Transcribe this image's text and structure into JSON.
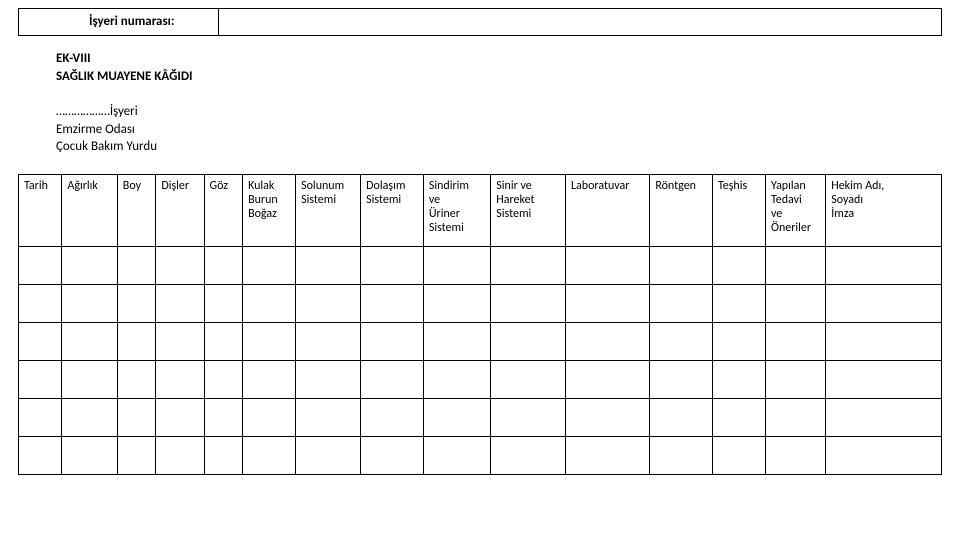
{
  "top_field": {
    "label": "İşyeri numarası:",
    "value": ""
  },
  "section_code": "EK-VIII",
  "section_title": "SAĞLIK MUAYENE KÂĞIDI",
  "institution_line1": "………………İşyeri",
  "institution_line2": "Emzirme Odası",
  "institution_line3": "Çocuk Bakım Yurdu",
  "columns": {
    "tarih": "Tarih",
    "agirlik": "Ağırlık",
    "boy": "Boy",
    "disler": "Dişler",
    "goz": "Göz",
    "kulak": "Kulak\nBurun\nBoğaz",
    "solunum": "Solunum\nSistemi",
    "dolasim": "Dolaşım\nSistemi",
    "sindirim": "Sindirim\nve\nÜriner\nSistemi",
    "sinir": "Sinir ve\nHareket\nSistemi",
    "lab": "Laboratuvar",
    "rontgen": "Röntgen",
    "teshis": "Teşhis",
    "yapilan": "Yapılan\nTedavi\nve\nÖneriler",
    "hekim": "Hekim Adı,\nSoyadı\nİmza"
  },
  "rows": [
    {},
    {},
    {},
    {},
    {},
    {}
  ]
}
